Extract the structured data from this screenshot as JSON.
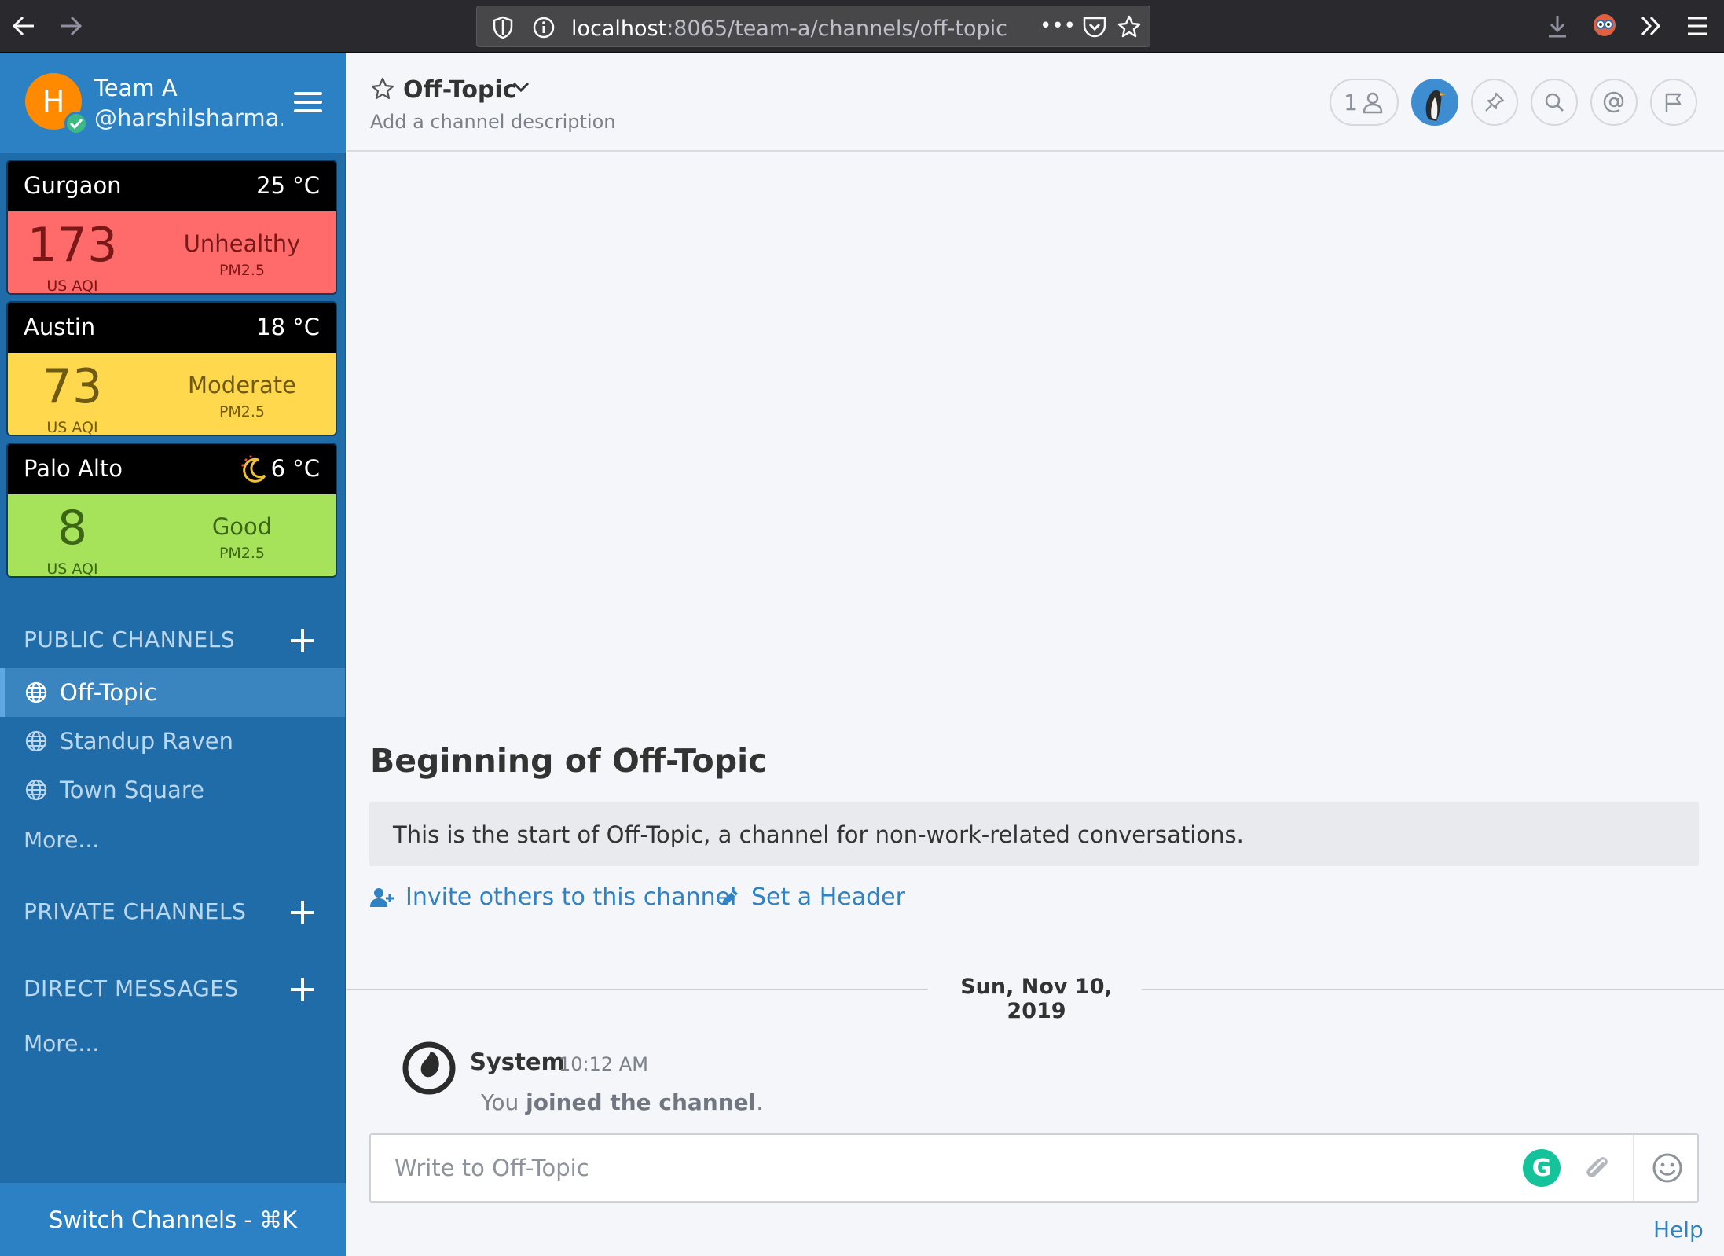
{
  "browser": {
    "url_host": "localhost",
    "url_path": ":8065/team-a/channels/off-topic",
    "more_glyph": "•••"
  },
  "team": {
    "avatar_letter": "H",
    "name": "Team A",
    "username": "@harshilsharma..."
  },
  "aqi_cards": [
    {
      "city": "Gurgaon",
      "temp": "25 °C",
      "aqi": "173",
      "unit": "US AQI",
      "level": "Unhealthy",
      "pollutant": "PM2.5",
      "color": "#ff6b6b"
    },
    {
      "city": "Austin",
      "temp": "18 °C",
      "aqi": "73",
      "unit": "US AQI",
      "level": "Moderate",
      "pollutant": "PM2.5",
      "color": "#ffd84d"
    },
    {
      "city": "Palo Alto",
      "temp": "6 °C",
      "aqi": "8",
      "unit": "US AQI",
      "level": "Good",
      "pollutant": "PM2.5",
      "color": "#a7e35a"
    }
  ],
  "sidebar": {
    "public_title": "PUBLIC CHANNELS",
    "public_channels": [
      {
        "label": "Off-Topic",
        "active": true
      },
      {
        "label": "Standup Raven",
        "active": false
      },
      {
        "label": "Town Square",
        "active": false
      }
    ],
    "public_more": "More...",
    "private_title": "PRIVATE CHANNELS",
    "direct_title": "DIRECT MESSAGES",
    "direct_more": "More...",
    "switch_channels": "Switch Channels - ⌘K"
  },
  "channel": {
    "name": "Off-Topic",
    "description": "Add a channel description",
    "member_count": "1"
  },
  "intro": {
    "title": "Beginning of Off-Topic",
    "text": "This is the start of Off-Topic, a channel for non-work-related conversations.",
    "invite_link": "Invite others to this channel",
    "header_link": "Set a Header"
  },
  "date_separator": "Sun, Nov 10, 2019",
  "post": {
    "author": "System",
    "time": "10:12 AM",
    "body_prefix": "You ",
    "body_bold": "joined the channel",
    "body_suffix": "."
  },
  "composer": {
    "placeholder": "Write to Off-Topic",
    "grammarly_letter": "G"
  },
  "help": "Help",
  "colors": {
    "sidebar_bg": "#1f6ca8",
    "team_header_bg": "#2c81c4",
    "link": "#2f82c4",
    "status_online": "#3db887"
  }
}
